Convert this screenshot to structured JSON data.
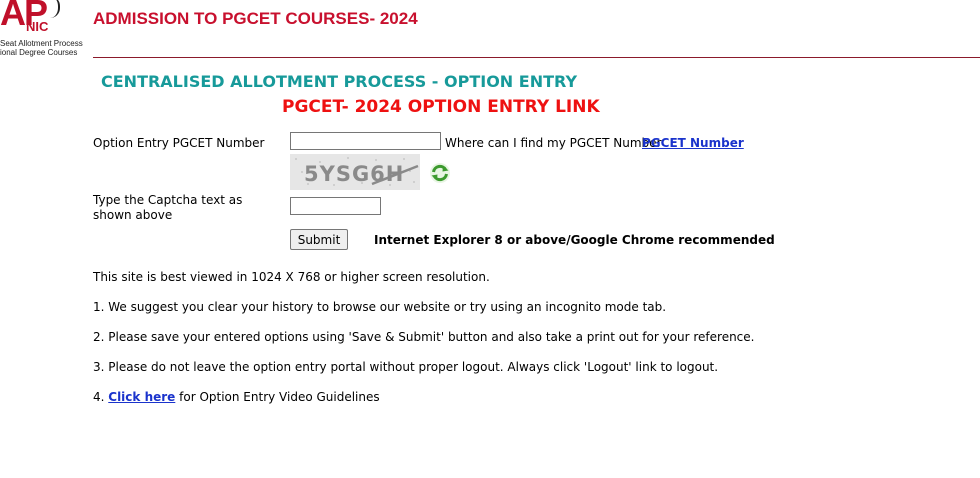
{
  "logo": {
    "ap": "AP",
    "nic": "NIC",
    "line1": "Seat Allotment Process",
    "line2": "ional Degree Courses"
  },
  "header": {
    "title": "ADMISSION TO PGCET COURSES- 2024"
  },
  "page": {
    "subtitle": "CENTRALISED ALLOTMENT PROCESS - OPTION ENTRY",
    "main_title": "PGCET- 2024 OPTION ENTRY LINK"
  },
  "form": {
    "pgcet_label": "Option Entry PGCET Number",
    "pgcet_value": "",
    "where_text": "Where can I find my PGCET Number",
    "pgcet_link": "PGCET Number",
    "captcha_text": "5YSG6H",
    "captcha_label": "Type the Captcha text as shown above",
    "captcha_value": "",
    "submit_label": "Submit",
    "browser_note": "Internet Explorer 8 or above/Google Chrome recommended"
  },
  "info": {
    "view_note": "This site is best viewed in 1024 X 768 or higher screen resolution.",
    "item1": "1. We suggest you clear your history to browse our website or try using an incognito mode tab.",
    "item2": "2. Please save your entered options using 'Save & Submit' button and also take a print out for your reference.",
    "item3": "3. Please do not leave the option entry portal without proper logout. Always click 'Logout' link to logout.",
    "item4_prefix": "4. ",
    "item4_link": "Click here",
    "item4_suffix": " for Option Entry Video Guidelines"
  },
  "colors": {
    "header_red": "#c8102e",
    "subtitle_teal": "#179a9a",
    "main_title_red": "#ee1111",
    "link_blue": "#1a33cc"
  },
  "icons": {
    "refresh": "refresh-icon"
  }
}
